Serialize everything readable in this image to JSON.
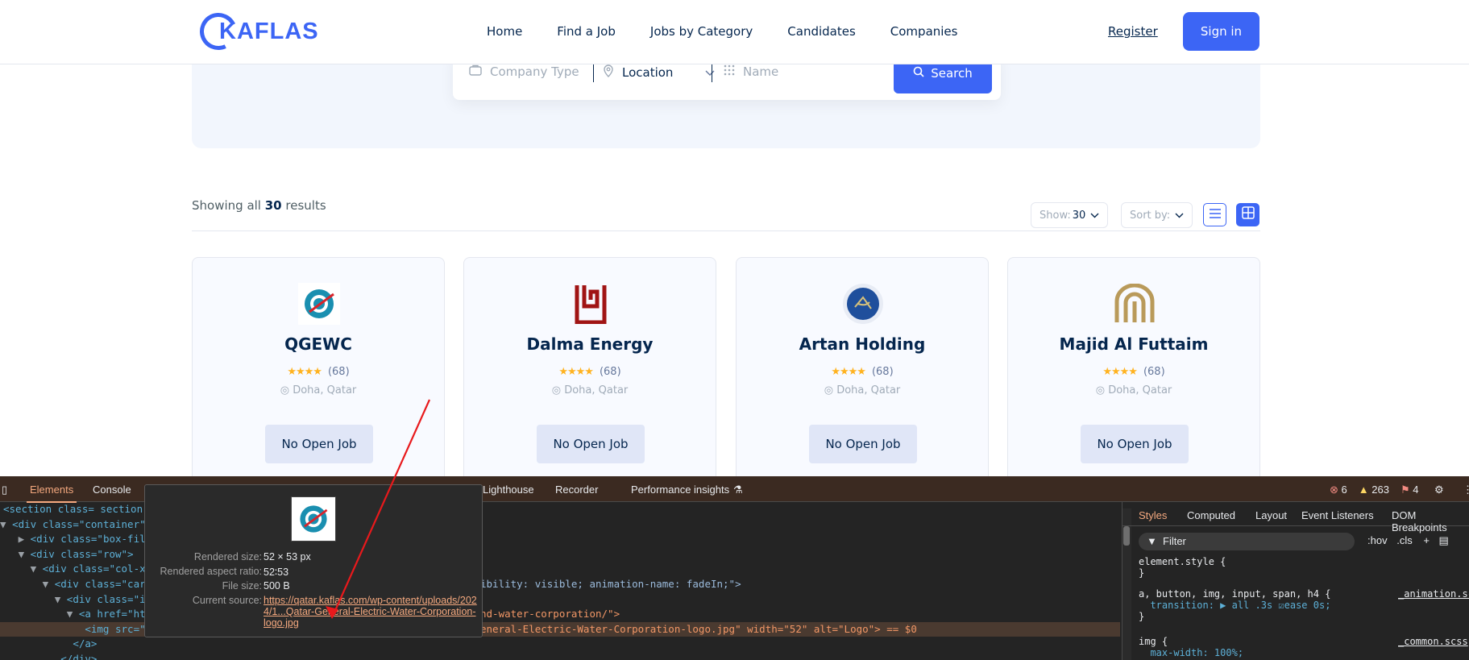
{
  "header": {
    "logo_text": "KAFLAS",
    "nav": [
      "Home",
      "Find a Job",
      "Jobs by Category",
      "Candidates",
      "Companies"
    ],
    "register": "Register",
    "signin": "Sign in"
  },
  "search": {
    "company_type_placeholder": "Company Type",
    "location": "Location",
    "name_placeholder": "Name",
    "button": "Search"
  },
  "results": {
    "showing_prefix": "Showing all",
    "count": "30",
    "showing_suffix": "results",
    "show_label": "Show:",
    "show_value": "30",
    "sort_label": "Sort by:"
  },
  "companies": [
    {
      "name": "QGEWC",
      "reviews": "(68)",
      "location": "Doha, Qatar",
      "button": "No Open Job"
    },
    {
      "name": "Dalma Energy",
      "reviews": "(68)",
      "location": "Doha, Qatar",
      "button": "No Open Job"
    },
    {
      "name": "Artan Holding",
      "reviews": "(68)",
      "location": "Doha, Qatar",
      "button": "No Open Job"
    },
    {
      "name": "Majid Al Futtaim",
      "reviews": "(68)",
      "location": "Doha, Qatar",
      "button": "No Open Job"
    }
  ],
  "devtools": {
    "tabs": [
      "Elements",
      "Console",
      "Lighthouse",
      "Recorder",
      "Performance insights"
    ],
    "errors": "6",
    "warnings": "263",
    "issues": "4",
    "styles_tabs": [
      "Styles",
      "Computed",
      "Layout",
      "Event Listeners",
      "DOM Breakpoints"
    ],
    "filter": "Filter",
    "hov": ":hov",
    "cls": ".cls",
    "code_lines": [
      "<section class= section-",
      "<div class=\"container\"",
      "<div class=\"box-filte",
      "<div class=\"row\">",
      "<div class=\"col-xl-",
      "<div class=\"card-",
      "<div class=\"ima",
      "<a href=\"https",
      "<img src=\"ht",
      "</a>",
      "</div>"
    ],
    "code_tail": [
      "ibility: visible; animation-name: fadeIn;\">",
      "nd-water-corporation/\">",
      "eneral-Electric-Water-Corporation-logo.jpg\" width=\"52\" alt=\"Logo\"> == $0"
    ],
    "style_rules": [
      {
        "selector": "element.style {",
        "body": "}",
        "source": ""
      },
      {
        "selector": "a, button, img, input, span, h4 {",
        "body": "transition: ▶ all .3s ☑ease 0s;",
        "source": "_animation.scss"
      },
      {
        "selector": "img {",
        "body": "max-width: 100%;",
        "source": "_common.scss"
      }
    ]
  },
  "tooltip": {
    "rendered_size_label": "Rendered size:",
    "rendered_size": "52 × 53 px",
    "aspect_label": "Rendered aspect ratio:",
    "aspect": "52∶53",
    "file_size_label": "File size:",
    "file_size": "500 B",
    "source_label": "Current source:",
    "source": "https://qatar.kaflas.com/wp-content/uploads/2024/1...Qatar-General-Electric-Water-Corporation-logo.jpg"
  },
  "colors": {
    "accent": "#3c65f5",
    "annotation_arrow": "#e8191c"
  }
}
